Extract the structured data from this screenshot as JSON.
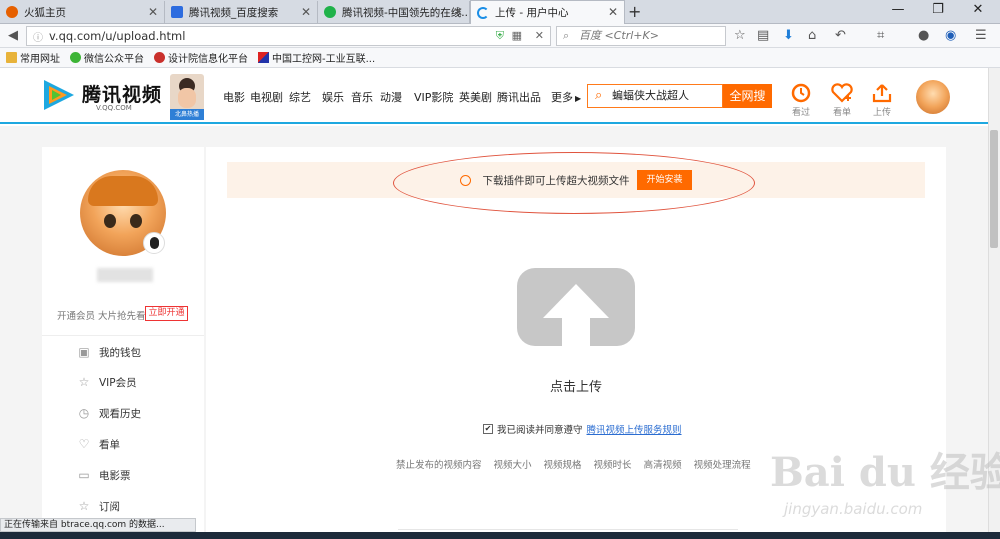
{
  "browser": {
    "tabs": [
      {
        "label": "火狐主页",
        "icon": "firefox-icon",
        "color": "#e66000"
      },
      {
        "label": "腾讯视频_百度搜索",
        "icon": "baidu-icon",
        "color": "#2d6cdf"
      },
      {
        "label": "腾讯视频-中国领先的在线...",
        "icon": "tencent-video-icon",
        "color": "#20b24a"
      },
      {
        "label": "上传 - 用户中心",
        "icon": "loading-icon",
        "color": "#1a8ee6"
      }
    ],
    "new_tab": "+",
    "window_controls": [
      "—",
      "❐",
      "✕"
    ],
    "url": "v.qq.com/u/upload.html",
    "search_placeholder": "百度 <Ctrl+K>",
    "bookmarks": [
      {
        "label": "常用网址",
        "icon": "folder-icon"
      },
      {
        "label": "微信公众平台",
        "icon": "wechat-icon"
      },
      {
        "label": "设计院信息化平台",
        "icon": "gear-icon"
      },
      {
        "label": "中国工控网-工业互联...",
        "icon": "flag-icon"
      }
    ],
    "status": "正在传输来自 btrace.qq.com 的数据..."
  },
  "site": {
    "logo_text": "腾讯视频",
    "logo_sub": "V.QQ.COM",
    "promo_caption": "北鼻热播",
    "nav": [
      "电影",
      "电视剧",
      "综艺",
      "娱乐",
      "音乐",
      "动漫",
      "VIP影院",
      "英美剧",
      "腾讯出品",
      "更多"
    ],
    "search_value": "蝙蝠侠大战超人",
    "search_button": "全网搜",
    "header_icons": [
      {
        "label": "看过",
        "icon": "history-icon"
      },
      {
        "label": "看单",
        "icon": "heart-plus-icon"
      },
      {
        "label": "上传",
        "icon": "upload-icon"
      }
    ],
    "accent": "#ff6a00",
    "brand_blue": "#1ea8e0"
  },
  "sidebar": {
    "member_text": "开通会员 大片抢先看",
    "member_button": "立即开通",
    "items": [
      {
        "label": "我的钱包",
        "icon": "wallet-icon"
      },
      {
        "label": "VIP会员",
        "icon": "star-icon"
      },
      {
        "label": "观看历史",
        "icon": "clock-icon"
      },
      {
        "label": "看单",
        "icon": "heart-icon"
      },
      {
        "label": "电影票",
        "icon": "ticket-icon"
      },
      {
        "label": "订阅",
        "icon": "star-outline-icon"
      }
    ]
  },
  "main": {
    "plugin_text": "下载插件即可上传超大视频文件",
    "plugin_button": "开始安装",
    "upload_title": "点击上传",
    "agree_text": "我已阅读并同意遵守",
    "agree_link": "腾讯视频上传服务规则",
    "agree_checked": true,
    "rules": [
      "禁止发布的视频内容",
      "视频大小",
      "视频规格",
      "视频时长",
      "高清视频",
      "视频处理流程"
    ]
  },
  "watermark": {
    "line1": "Bai du 经验",
    "line2": "jingyan.baidu.com"
  }
}
